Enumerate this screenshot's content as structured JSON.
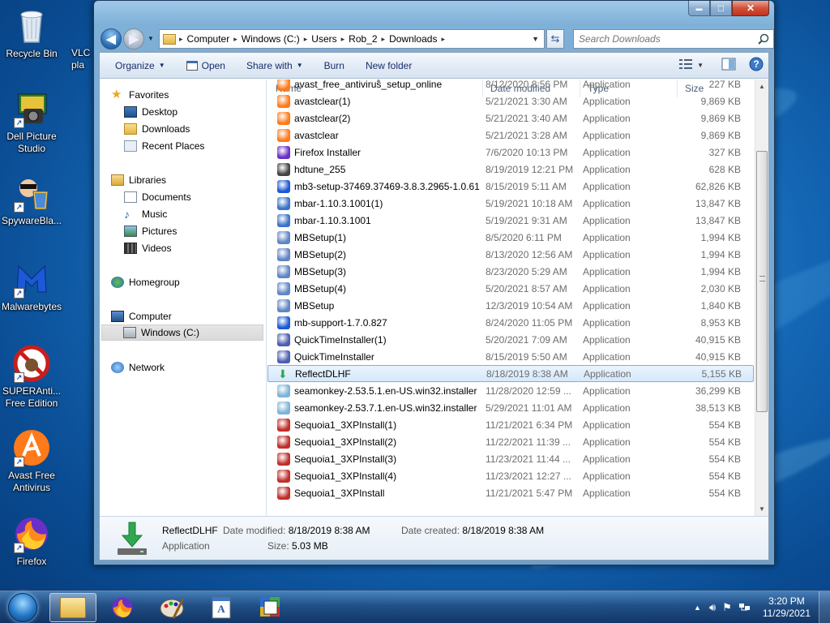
{
  "desktop": {
    "icons": [
      {
        "label": "Recycle Bin"
      },
      {
        "label": "VLC\npla"
      },
      {
        "label": "Dell Picture\nStudio"
      },
      {
        "label": "SpywareBla..."
      },
      {
        "label": "Malwarebytes"
      },
      {
        "label": "SUPERAnti...\nFree Edition"
      },
      {
        "label": "Avast Free\nAntivirus"
      },
      {
        "label": "Firefox"
      }
    ]
  },
  "window": {
    "caption": {
      "minimize": "▬",
      "maximize": "□",
      "close": "✕"
    },
    "address": {
      "segments": [
        "Computer",
        "Windows (C:)",
        "Users",
        "Rob_2",
        "Downloads"
      ],
      "separator": "▸"
    },
    "search_placeholder": "Search Downloads",
    "toolbar": {
      "organize": "Organize",
      "open": "Open",
      "share_with": "Share with",
      "burn": "Burn",
      "new_folder": "New folder"
    },
    "nav_pane": {
      "favorites": "Favorites",
      "desktop": "Desktop",
      "downloads": "Downloads",
      "recent_places": "Recent Places",
      "libraries": "Libraries",
      "documents": "Documents",
      "music": "Music",
      "pictures": "Pictures",
      "videos": "Videos",
      "homegroup": "Homegroup",
      "computer": "Computer",
      "windows_c": "Windows (C:)",
      "network": "Network"
    },
    "columns": {
      "name": "Name",
      "date": "Date modified",
      "type": "Type",
      "size": "Size"
    },
    "files": [
      {
        "name": "avast_free_antivirus_setup_online",
        "date": "8/12/2020 8:56 PM",
        "type": "Application",
        "size": "227 KB",
        "icon": "avast-icon"
      },
      {
        "name": "avastclear(1)",
        "date": "5/21/2021 3:30 AM",
        "type": "Application",
        "size": "9,869 KB",
        "icon": "avast-icon"
      },
      {
        "name": "avastclear(2)",
        "date": "5/21/2021 3:40 AM",
        "type": "Application",
        "size": "9,869 KB",
        "icon": "avast-icon"
      },
      {
        "name": "avastclear",
        "date": "5/21/2021 3:28 AM",
        "type": "Application",
        "size": "9,869 KB",
        "icon": "avast-icon"
      },
      {
        "name": "Firefox Installer",
        "date": "7/6/2020 10:13 PM",
        "type": "Application",
        "size": "327 KB",
        "icon": "firefox-installer-icon"
      },
      {
        "name": "hdtune_255",
        "date": "8/19/2019 12:21 PM",
        "type": "Application",
        "size": "628 KB",
        "icon": "hdtune-icon"
      },
      {
        "name": "mb3-setup-37469.37469-3.8.3.2965-1.0.61...",
        "date": "8/15/2019 5:11 AM",
        "type": "Application",
        "size": "62,826 KB",
        "icon": "malwarebytes-icon"
      },
      {
        "name": "mbar-1.10.3.1001(1)",
        "date": "5/19/2021 10:18 AM",
        "type": "Application",
        "size": "13,847 KB",
        "icon": "mbar-icon"
      },
      {
        "name": "mbar-1.10.3.1001",
        "date": "5/19/2021 9:31 AM",
        "type": "Application",
        "size": "13,847 KB",
        "icon": "mbar-icon"
      },
      {
        "name": "MBSetup(1)",
        "date": "8/5/2020 6:11 PM",
        "type": "Application",
        "size": "1,994 KB",
        "icon": "mbsetup-icon"
      },
      {
        "name": "MBSetup(2)",
        "date": "8/13/2020 12:56 AM",
        "type": "Application",
        "size": "1,994 KB",
        "icon": "mbsetup-icon"
      },
      {
        "name": "MBSetup(3)",
        "date": "8/23/2020 5:29 AM",
        "type": "Application",
        "size": "1,994 KB",
        "icon": "mbsetup-icon"
      },
      {
        "name": "MBSetup(4)",
        "date": "5/20/2021 8:57 AM",
        "type": "Application",
        "size": "2,030 KB",
        "icon": "mbsetup-icon"
      },
      {
        "name": "MBSetup",
        "date": "12/3/2019 10:54 AM",
        "type": "Application",
        "size": "1,840 KB",
        "icon": "mbsetup-icon"
      },
      {
        "name": "mb-support-1.7.0.827",
        "date": "8/24/2020 11:05 PM",
        "type": "Application",
        "size": "8,953 KB",
        "icon": "malwarebytes-icon"
      },
      {
        "name": "QuickTimeInstaller(1)",
        "date": "5/20/2021 7:09 AM",
        "type": "Application",
        "size": "40,915 KB",
        "icon": "quicktime-icon"
      },
      {
        "name": "QuickTimeInstaller",
        "date": "8/15/2019 5:50 AM",
        "type": "Application",
        "size": "40,915 KB",
        "icon": "quicktime-icon"
      },
      {
        "name": "ReflectDLHF",
        "date": "8/18/2019 8:38 AM",
        "type": "Application",
        "size": "5,155 KB",
        "icon": "download-arrow-icon",
        "selected": true
      },
      {
        "name": "seamonkey-2.53.5.1.en-US.win32.installer",
        "date": "11/28/2020 12:59 ...",
        "type": "Application",
        "size": "36,299 KB",
        "icon": "seamonkey-icon"
      },
      {
        "name": "seamonkey-2.53.7.1.en-US.win32.installer",
        "date": "5/29/2021 11:01 AM",
        "type": "Application",
        "size": "38,513 KB",
        "icon": "seamonkey-icon"
      },
      {
        "name": "Sequoia1_3XPInstall(1)",
        "date": "11/21/2021 6:34 PM",
        "type": "Application",
        "size": "554 KB",
        "icon": "sequoia-icon"
      },
      {
        "name": "Sequoia1_3XPInstall(2)",
        "date": "11/22/2021 11:39 ...",
        "type": "Application",
        "size": "554 KB",
        "icon": "sequoia-icon"
      },
      {
        "name": "Sequoia1_3XPInstall(3)",
        "date": "11/23/2021 11:44 ...",
        "type": "Application",
        "size": "554 KB",
        "icon": "sequoia-icon"
      },
      {
        "name": "Sequoia1_3XPInstall(4)",
        "date": "11/23/2021 12:27 ...",
        "type": "Application",
        "size": "554 KB",
        "icon": "sequoia-icon"
      },
      {
        "name": "Sequoia1_3XPInstall",
        "date": "11/21/2021 5:47 PM",
        "type": "Application",
        "size": "554 KB",
        "icon": "sequoia-icon"
      }
    ],
    "details": {
      "name": "ReflectDLHF",
      "type": "Application",
      "date_modified_label": "Date modified:",
      "date_modified": "8/18/2019 8:38 AM",
      "date_created_label": "Date created:",
      "date_created": "8/18/2019 8:38 AM",
      "size_label": "Size:",
      "size": "5.03 MB"
    }
  },
  "taskbar": {
    "time": "3:20 PM",
    "date": "11/29/2021"
  },
  "colors": {
    "selection_border": "#84acdd",
    "selection_fill": "#d5e8fb",
    "toolbar_text": "#1a2d6b",
    "muted_text": "#6d6d6d"
  }
}
